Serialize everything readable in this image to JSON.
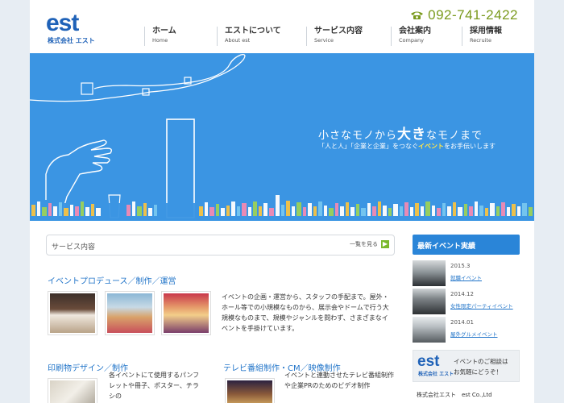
{
  "header": {
    "logo_main": "est",
    "logo_sub": "株式会社 エスト",
    "phone": "092-741-2422"
  },
  "nav": [
    {
      "jp": "ホーム",
      "en": "Home"
    },
    {
      "jp": "エストについて",
      "en": "About est"
    },
    {
      "jp": "サービス内容",
      "en": "Service"
    },
    {
      "jp": "会社案内",
      "en": "Company"
    },
    {
      "jp": "採用情報",
      "en": "Recruite"
    }
  ],
  "hero": {
    "title_a": "小さなモノから",
    "title_big": "大き",
    "title_b": "なモノまで",
    "sub_a": "「人と人」「企業と企業」をつなぐ",
    "sub_hl": "イベント",
    "sub_b": "をお手伝いします"
  },
  "service_bar": {
    "label": "サービス内容",
    "more": "一覧を見る"
  },
  "sections": {
    "event": {
      "title": "イベントプロデュース／制作／運営",
      "desc": "イベントの企画・運営から、スタッフの手配まで。屋外・ホール等での小規模なものから、展示会やドームで行う大規模なものまで、規模やジャンルを問わず、さまざまなイベントを手掛けています。"
    },
    "print": {
      "title": "印刷物デザイン／制作",
      "desc": "各イベントにて使用するパンフレットや冊子、ポスター、チラシの"
    },
    "tv": {
      "title": "テレビ番組制作・CM／映像制作",
      "desc": "イベントと連動させたテレビ番組制作や企業PRのためのビデオ制作"
    }
  },
  "sidebar": {
    "heading": "最新イベント実績",
    "events": [
      {
        "date": "2015.3",
        "link": "就職イベント"
      },
      {
        "date": "2014.12",
        "link": "女性限定パーティイベント"
      },
      {
        "date": "2014.01",
        "link": "屋外グルメイベント"
      }
    ],
    "contact": {
      "logo_main": "est",
      "logo_sub": "株式会社 エスト",
      "line1": "イベントのご相談は",
      "line2": "お気軽にどうぞ！"
    },
    "company": "株式会社エスト　est Co.,Ltd"
  },
  "colors": {
    "brand": "#1f62b8",
    "hero": "#3b95e3",
    "accent_green": "#7a9a1d",
    "link": "#2275c9"
  }
}
